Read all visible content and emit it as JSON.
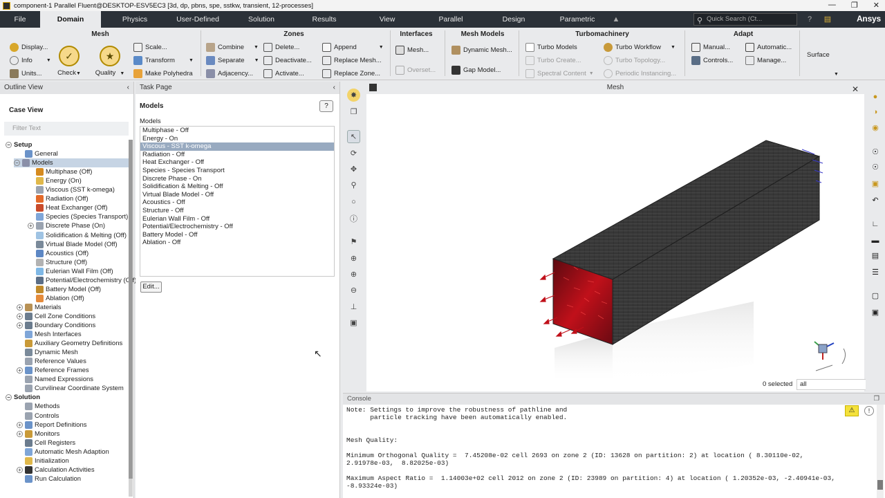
{
  "window": {
    "title": "component-1 Parallel Fluent@DESKTOP-ESV5EC3  [3d, dp, pbns, spe, sstkw, transient, 12-processes]"
  },
  "menu": {
    "items": [
      "File",
      "Domain",
      "Physics",
      "User-Defined",
      "Solution",
      "Results",
      "View",
      "Parallel",
      "Design",
      "Parametric"
    ],
    "active": "Domain",
    "search_placeholder": "Quick Search (Ct...",
    "brand": "Ansys"
  },
  "ribbon": {
    "mesh": {
      "title": "Mesh",
      "display": "Display...",
      "info": "Info",
      "units": "Units...",
      "check": "Check",
      "quality": "Quality",
      "scale": "Scale...",
      "transform": "Transform",
      "make_polyhedra": "Make Polyhedra"
    },
    "zones": {
      "title": "Zones",
      "combine": "Combine",
      "separate": "Separate",
      "adjacency": "Adjacency...",
      "delete": "Delete...",
      "deactivate": "Deactivate...",
      "activate": "Activate...",
      "append": "Append",
      "replace_mesh": "Replace Mesh...",
      "replace_zone": "Replace Zone..."
    },
    "interfaces": {
      "title": "Interfaces",
      "mesh": "Mesh...",
      "overset": "Overset..."
    },
    "mesh_models": {
      "title": "Mesh Models",
      "dynamic_mesh": "Dynamic Mesh...",
      "gap_model": "Gap Model..."
    },
    "turbo": {
      "title": "Turbomachinery",
      "turbo_models": "Turbo Models",
      "turbo_create": "Turbo Create...",
      "spectral_content": "Spectral Content",
      "turbo_workflow": "Turbo Workflow",
      "turbo_topology": "Turbo Topology...",
      "periodic_instancing": "Periodic Instancing..."
    },
    "adapt": {
      "title": "Adapt",
      "manual": "Manual...",
      "controls": "Controls...",
      "automatic": "Automatic...",
      "manage": "Manage..."
    },
    "surface": {
      "label": "Surface"
    }
  },
  "outline": {
    "title": "Outline View",
    "case_view": "Case View",
    "filter_placeholder": "Filter Text",
    "tree": [
      {
        "label": "Setup",
        "level": 0,
        "bold": true,
        "exp": "-",
        "icon": ""
      },
      {
        "label": "General",
        "level": 1,
        "icon": "#6b93c9"
      },
      {
        "label": "Models",
        "level": 1,
        "exp": "-",
        "icon": "#8a8fa8",
        "selected": true
      },
      {
        "label": "Multiphase (Off)",
        "level": 2,
        "icon": "#d58a1f"
      },
      {
        "label": "Energy (On)",
        "level": 2,
        "icon": "#e0b84a"
      },
      {
        "label": "Viscous (SST k-omega)",
        "level": 2,
        "icon": "#9aa3b0"
      },
      {
        "label": "Radiation (Off)",
        "level": 2,
        "icon": "#e36a2a"
      },
      {
        "label": "Heat Exchanger (Off)",
        "level": 2,
        "icon": "#c94b2a"
      },
      {
        "label": "Species (Species Transport)",
        "level": 2,
        "icon": "#7fa6d8"
      },
      {
        "label": "Discrete Phase (On)",
        "level": 2,
        "exp": "+",
        "icon": "#9aa3b0"
      },
      {
        "label": "Solidification & Melting (Off)",
        "level": 2,
        "icon": "#9fc3e3"
      },
      {
        "label": "Virtual Blade Model (Off)",
        "level": 2,
        "icon": "#7a8a9a"
      },
      {
        "label": "Acoustics (Off)",
        "level": 2,
        "icon": "#5d87c4"
      },
      {
        "label": "Structure (Off)",
        "level": 2,
        "icon": "#b2b2b2"
      },
      {
        "label": "Eulerian Wall Film (Off)",
        "level": 2,
        "icon": "#7fb8e6"
      },
      {
        "label": "Potential/Electrochemistry (Off)",
        "level": 2,
        "icon": "#5b6e86"
      },
      {
        "label": "Battery Model (Off)",
        "level": 2,
        "icon": "#c08a2a"
      },
      {
        "label": "Ablation (Off)",
        "level": 2,
        "icon": "#e58b3b"
      },
      {
        "label": "Materials",
        "level": 1,
        "exp": "+",
        "icon": "#b89155"
      },
      {
        "label": "Cell Zone Conditions",
        "level": 1,
        "exp": "+",
        "icon": "#6b7c8e"
      },
      {
        "label": "Boundary Conditions",
        "level": 1,
        "exp": "+",
        "icon": "#6b7c8e"
      },
      {
        "label": "Mesh Interfaces",
        "level": 1,
        "icon": "#7fa6d8"
      },
      {
        "label": "Auxiliary Geometry Definitions",
        "level": 1,
        "icon": "#c99a38"
      },
      {
        "label": "Dynamic Mesh",
        "level": 1,
        "icon": "#7a8a9a"
      },
      {
        "label": "Reference Values",
        "level": 1,
        "icon": "#9aa3b0"
      },
      {
        "label": "Reference Frames",
        "level": 1,
        "exp": "+",
        "icon": "#6b93c9"
      },
      {
        "label": "Named Expressions",
        "level": 1,
        "icon": "#9aa3b0"
      },
      {
        "label": "Curvilinear Coordinate System",
        "level": 1,
        "icon": "#9aa3b0"
      },
      {
        "label": "Solution",
        "level": 0,
        "bold": true,
        "exp": "-",
        "icon": ""
      },
      {
        "label": "Methods",
        "level": 1,
        "icon": "#9aa3b0"
      },
      {
        "label": "Controls",
        "level": 1,
        "icon": "#9aa3b0"
      },
      {
        "label": "Report Definitions",
        "level": 1,
        "exp": "+",
        "icon": "#6b93c9"
      },
      {
        "label": "Monitors",
        "level": 1,
        "exp": "+",
        "icon": "#c99a38"
      },
      {
        "label": "Cell Registers",
        "level": 1,
        "icon": "#6b7c8e"
      },
      {
        "label": "Automatic Mesh Adaption",
        "level": 1,
        "icon": "#7fa6d8"
      },
      {
        "label": "Initialization",
        "level": 1,
        "icon": "#e0b84a"
      },
      {
        "label": "Calculation Activities",
        "level": 1,
        "exp": "+",
        "icon": "#333333"
      },
      {
        "label": "Run Calculation",
        "level": 1,
        "icon": "#6b93c9"
      }
    ]
  },
  "task_page": {
    "title": "Task Page",
    "heading": "Models",
    "list_label": "Models",
    "help_label": "?",
    "models": [
      "Multiphase - Off",
      "Energy - On",
      "Viscous - SST k-omega",
      "Radiation - Off",
      "Heat Exchanger - Off",
      "Species - Species Transport",
      "Discrete Phase - On",
      "Solidification & Melting - Off",
      "Virtual Blade Model - Off",
      "Acoustics - Off",
      "Structure - Off",
      "Eulerian Wall Film - Off",
      "Potential/Electrochemistry - Off",
      "Battery Model - Off",
      "Ablation - Off"
    ],
    "selected_index": 2,
    "edit_label": "Edit..."
  },
  "graphics": {
    "title": "Mesh",
    "selected_count": "0 selected",
    "selection_filter": "all",
    "colors": {
      "mesh": "#2e2e2e",
      "inlet": "#c0101a",
      "arrows": "#c0101a",
      "outlet_arrows": "#3838c8"
    }
  },
  "console": {
    "title": "Console",
    "lines": [
      "Note: Settings to improve the robustness of pathline and",
      "      particle tracking have been automatically enabled.",
      "",
      "",
      "Mesh Quality:",
      "",
      "Minimum Orthogonal Quality =  7.45208e-02 cell 2693 on zone 2 (ID: 13628 on partition: 2) at location ( 8.30110e-02,",
      "2.91978e-03,  8.82025e-03)",
      "",
      "Maximum Aspect Ratio =  1.14003e+02 cell 2012 on zone 2 (ID: 23989 on partition: 4) at location ( 1.20352e-03, -2.40941e-03,",
      "-8.93324e-03)"
    ]
  }
}
